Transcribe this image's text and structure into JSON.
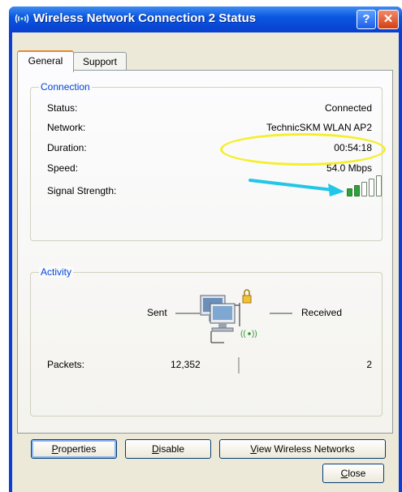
{
  "window": {
    "title": "Wireless Network Connection 2 Status",
    "icon": "wireless-network-icon",
    "help_label": "?",
    "close_label": "✕"
  },
  "tabs": [
    {
      "label": "General",
      "selected": true
    },
    {
      "label": "Support",
      "selected": false
    }
  ],
  "connection": {
    "legend": "Connection",
    "status_label": "Status:",
    "status_value": "Connected",
    "network_label": "Network:",
    "network_value": "TechnicSKM WLAN AP2",
    "duration_label": "Duration:",
    "duration_value": "00:54:18",
    "speed_label": "Speed:",
    "speed_value": "54.0 Mbps",
    "signal_label": "Signal Strength:",
    "signal_bars_total": 5,
    "signal_bars_lit": 2
  },
  "activity": {
    "legend": "Activity",
    "sent_label": "Sent",
    "received_label": "Received",
    "packets_label": "Packets:",
    "packets_sent": "12,352",
    "packets_received": "2"
  },
  "buttons": {
    "properties_prefix": "",
    "properties_key": "P",
    "properties_rest": "roperties",
    "disable_key": "D",
    "disable_rest": "isable",
    "view_key": "V",
    "view_rest": "iew Wireless Networks",
    "close_key": "C",
    "close_rest": "lose"
  },
  "colors": {
    "title_bar": "#0846d4",
    "dialog_bg": "#ece9d8",
    "group_legend": "#0046d5",
    "annotation_ellipse": "#f4ef2b",
    "annotation_arrow": "#22c6e6",
    "signal_on": "#2ea23a"
  }
}
